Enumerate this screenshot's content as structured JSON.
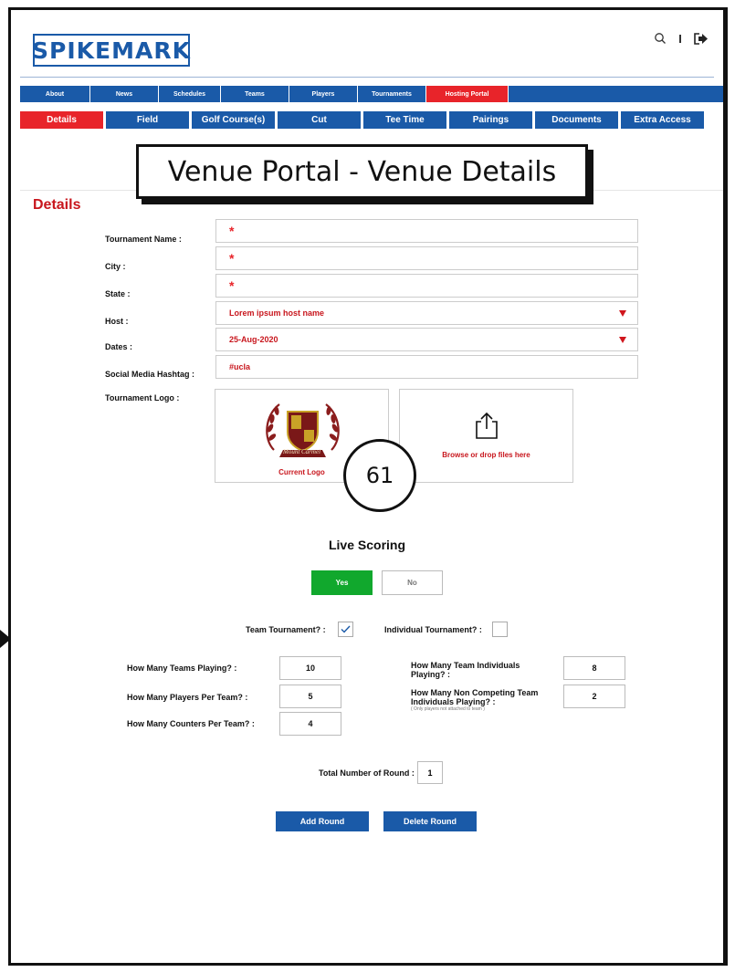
{
  "brand": {
    "logo_text": "SPIKEMARK"
  },
  "header_icons": [
    "search-icon",
    "logout-icon"
  ],
  "main_nav": [
    {
      "label": "About",
      "active": false
    },
    {
      "label": "News",
      "active": false
    },
    {
      "label": "Schedules",
      "active": false
    },
    {
      "label": "Teams",
      "active": false
    },
    {
      "label": "Players",
      "active": false
    },
    {
      "label": "Tournaments",
      "active": false
    },
    {
      "label": "Hosting Portal",
      "active": true
    }
  ],
  "sub_nav": [
    {
      "label": "Details",
      "active": true
    },
    {
      "label": "Field",
      "active": false
    },
    {
      "label": "Golf Course(s)",
      "active": false
    },
    {
      "label": "Cut",
      "active": false
    },
    {
      "label": "Tee Time",
      "active": false
    },
    {
      "label": "Pairings",
      "active": false
    },
    {
      "label": "Documents",
      "active": false
    },
    {
      "label": "Extra Access",
      "active": false
    }
  ],
  "banner": "Venue Portal - Venue Details",
  "section_title": "Details",
  "form": {
    "tournament_name": {
      "label": "Tournament Name :",
      "value": "",
      "required_mark": "*"
    },
    "city": {
      "label": "City :",
      "value": "",
      "required_mark": "*"
    },
    "state": {
      "label": "State :",
      "value": "",
      "required_mark": "*"
    },
    "host": {
      "label": "Host :",
      "value": "Lorem ipsum host name"
    },
    "dates": {
      "label": "Dates :",
      "value": "25-Aug-2020"
    },
    "hashtag": {
      "label": "Social Media Hashtag :",
      "value": "#ucla"
    },
    "logo": {
      "label": "Tournament Logo :",
      "current_caption": "Current Logo",
      "crest_text": "Mount Carmel",
      "upload_caption": "Browse or drop files here"
    }
  },
  "annotation_badge": "61",
  "live_scoring": {
    "title": "Live Scoring",
    "yes": "Yes",
    "no": "No",
    "selected": "Yes"
  },
  "tournament_type": {
    "team_label": "Team Tournament? :",
    "team_checked": true,
    "individual_label": "Individual Tournament? :",
    "individual_checked": false
  },
  "counts": {
    "teams_playing": {
      "label": "How Many Teams Playing? :",
      "value": "10"
    },
    "players_per_team": {
      "label": "How Many Players Per Team? :",
      "value": "5"
    },
    "counters_per_team": {
      "label": "How Many Counters Per Team? :",
      "value": "4"
    },
    "team_individuals": {
      "label": "How Many Team Individuals Playing? :",
      "value": "8"
    },
    "non_competing": {
      "label": "How Many Non Competing Team Individuals Playing? :",
      "note": "( Only players not attached to team )",
      "value": "2"
    }
  },
  "rounds": {
    "label": "Total Number of Round :",
    "value": "1"
  },
  "actions": {
    "add": "Add Round",
    "delete": "Delete Round"
  },
  "colors": {
    "brand_blue": "#1a5aa8",
    "accent_red": "#e8242a",
    "success_green": "#11a82d"
  }
}
